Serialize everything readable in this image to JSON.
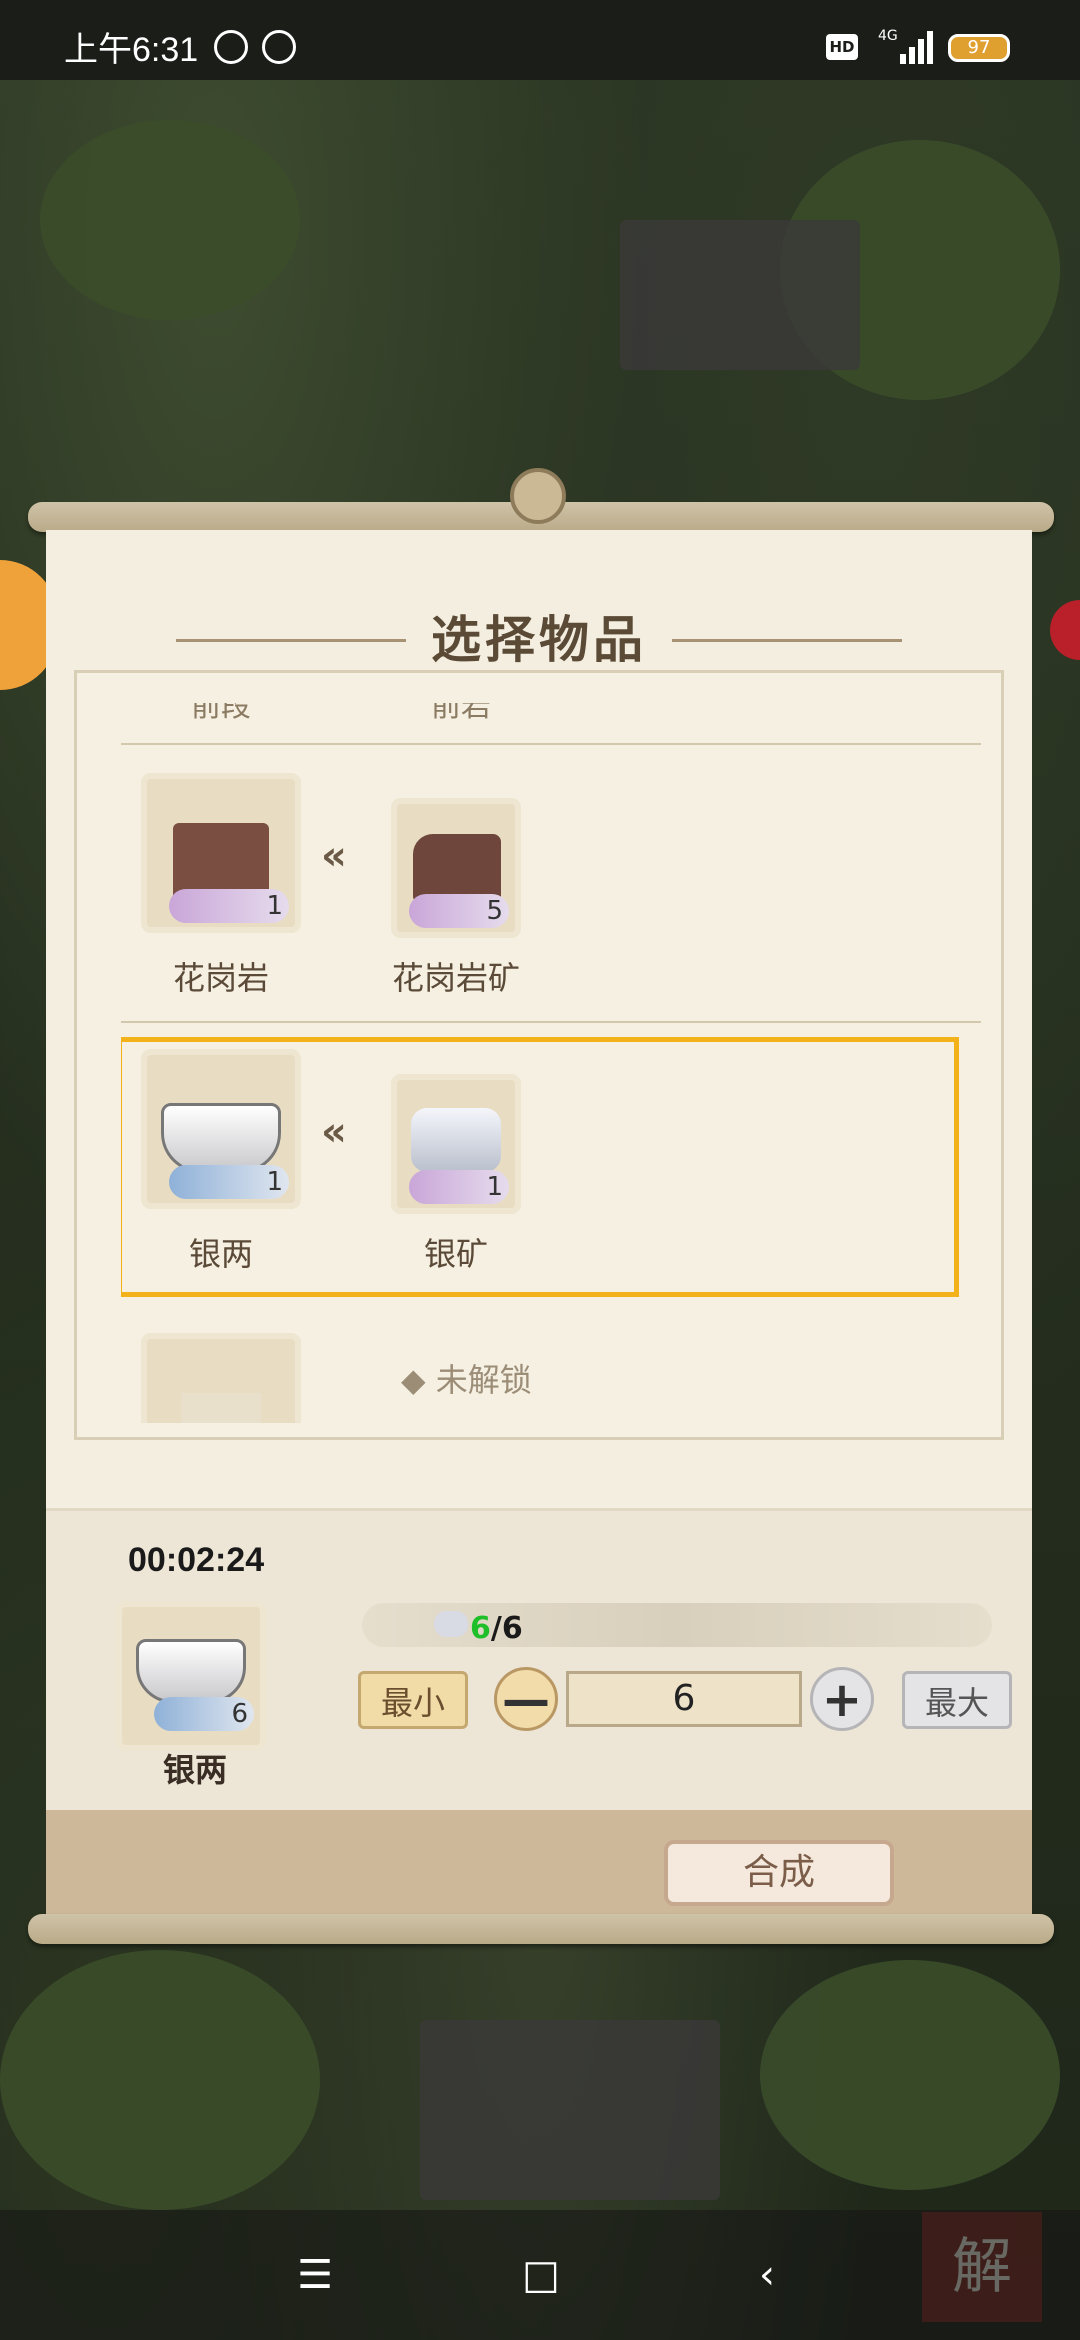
{
  "status_bar": {
    "time": "上午6:31",
    "hd": "HD",
    "network": "4G",
    "battery": "97"
  },
  "dialog": {
    "title": "选择物品",
    "cut_labels": [
      "前段",
      "前岩"
    ],
    "recipes": [
      {
        "output": {
          "name": "花岗岩",
          "count": "1"
        },
        "input": {
          "name": "花岗岩矿",
          "count": "5"
        }
      },
      {
        "output": {
          "name": "银两",
          "count": "1"
        },
        "input": {
          "name": "银矿",
          "count": "1"
        }
      }
    ],
    "locked_text": "未解锁",
    "arrow": "«"
  },
  "craft": {
    "timer": "00:02:24",
    "item_name": "银两",
    "item_count": "6",
    "progress_have": "6",
    "progress_need": "/6",
    "min_label": "最小",
    "max_label": "最大",
    "minus_label": "—",
    "plus_label": "+",
    "quantity": "6",
    "synth_label": "合成"
  },
  "nav": {
    "menu": "☰",
    "home": "□",
    "back": "‹"
  },
  "watermark": "解",
  "colors": {
    "accent_highlight": "#f3b21a",
    "progress_green": "#1fbf2a",
    "panel_bg": "#f3eedf"
  }
}
